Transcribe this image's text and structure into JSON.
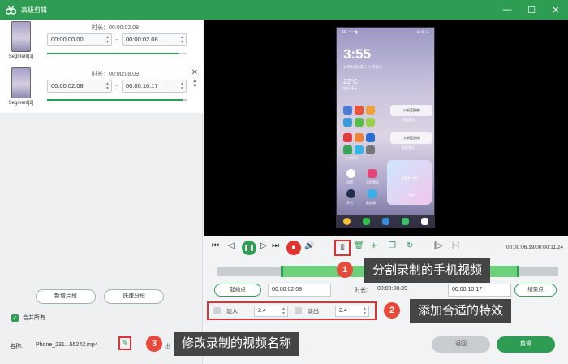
{
  "window": {
    "title": "高级剪辑",
    "controls": [
      "—",
      "☐",
      "✕"
    ]
  },
  "segments": [
    {
      "label": "Segment[1]",
      "duration": "时长：00:00:02.08",
      "start": "00:00:00.00",
      "end": "00:00:02.08",
      "progress": 0.95
    },
    {
      "label": "Segment[2]",
      "duration": "时长：00:00:08.09",
      "start": "00:00:02.08",
      "end": "00:00:10.17",
      "progress": 0.97
    }
  ],
  "left_buttons": {
    "new_segment": "新增片段",
    "quick_split": "快速分段"
  },
  "merge_all": {
    "label": "合并所有",
    "checked": true
  },
  "preview": {
    "status_left": "5G ⁴⁶ ᵃ ▮",
    "status_right": "⊙ ⊛ ▭",
    "clock": "3:55",
    "date": "11月15日 周三 十月初三",
    "temp": "22°C",
    "weather": "轻风·多云",
    "widget1": "小新蓝塑修",
    "widget1_sub": "智能建议",
    "widget2": "大新蓝塑修",
    "widget2_sub": "智能建议",
    "app_labels": [
      "工作学习",
      "",
      "",
      "设置",
      "手机管家",
      "",
      "天气",
      "备忘录"
    ],
    "card_title": "105天",
    "card_sub": "♡ 宝宝"
  },
  "time_display": "00:00:06.19/00:00:11.24",
  "range": {
    "start_btn": "起始点",
    "start_val": "00:00:02.08",
    "dur_label": "时长:",
    "dur_val": "00:00:08.09",
    "end_val": "00:00:10.17",
    "end_btn": "结束点"
  },
  "effects": {
    "fade_in_label": "淡入",
    "fade_in_val": "2.4",
    "fade_out_label": "淡出",
    "fade_out_val": "2.4"
  },
  "bottom": {
    "name_label": "名称:",
    "name_value": "Phone_231...55242.mp4",
    "back": "返回",
    "cut": "剪辑"
  },
  "callouts": [
    {
      "num": "1",
      "text": "分割录制的手机视频"
    },
    {
      "num": "2",
      "text": "添加合适的特效"
    },
    {
      "num": "3",
      "text": "修改录制的视频名称"
    }
  ],
  "colors": {
    "accent": "#2e9d53",
    "highlight": "#e0322f",
    "badge": "#e84a3a",
    "callout_bg": "#454545"
  }
}
